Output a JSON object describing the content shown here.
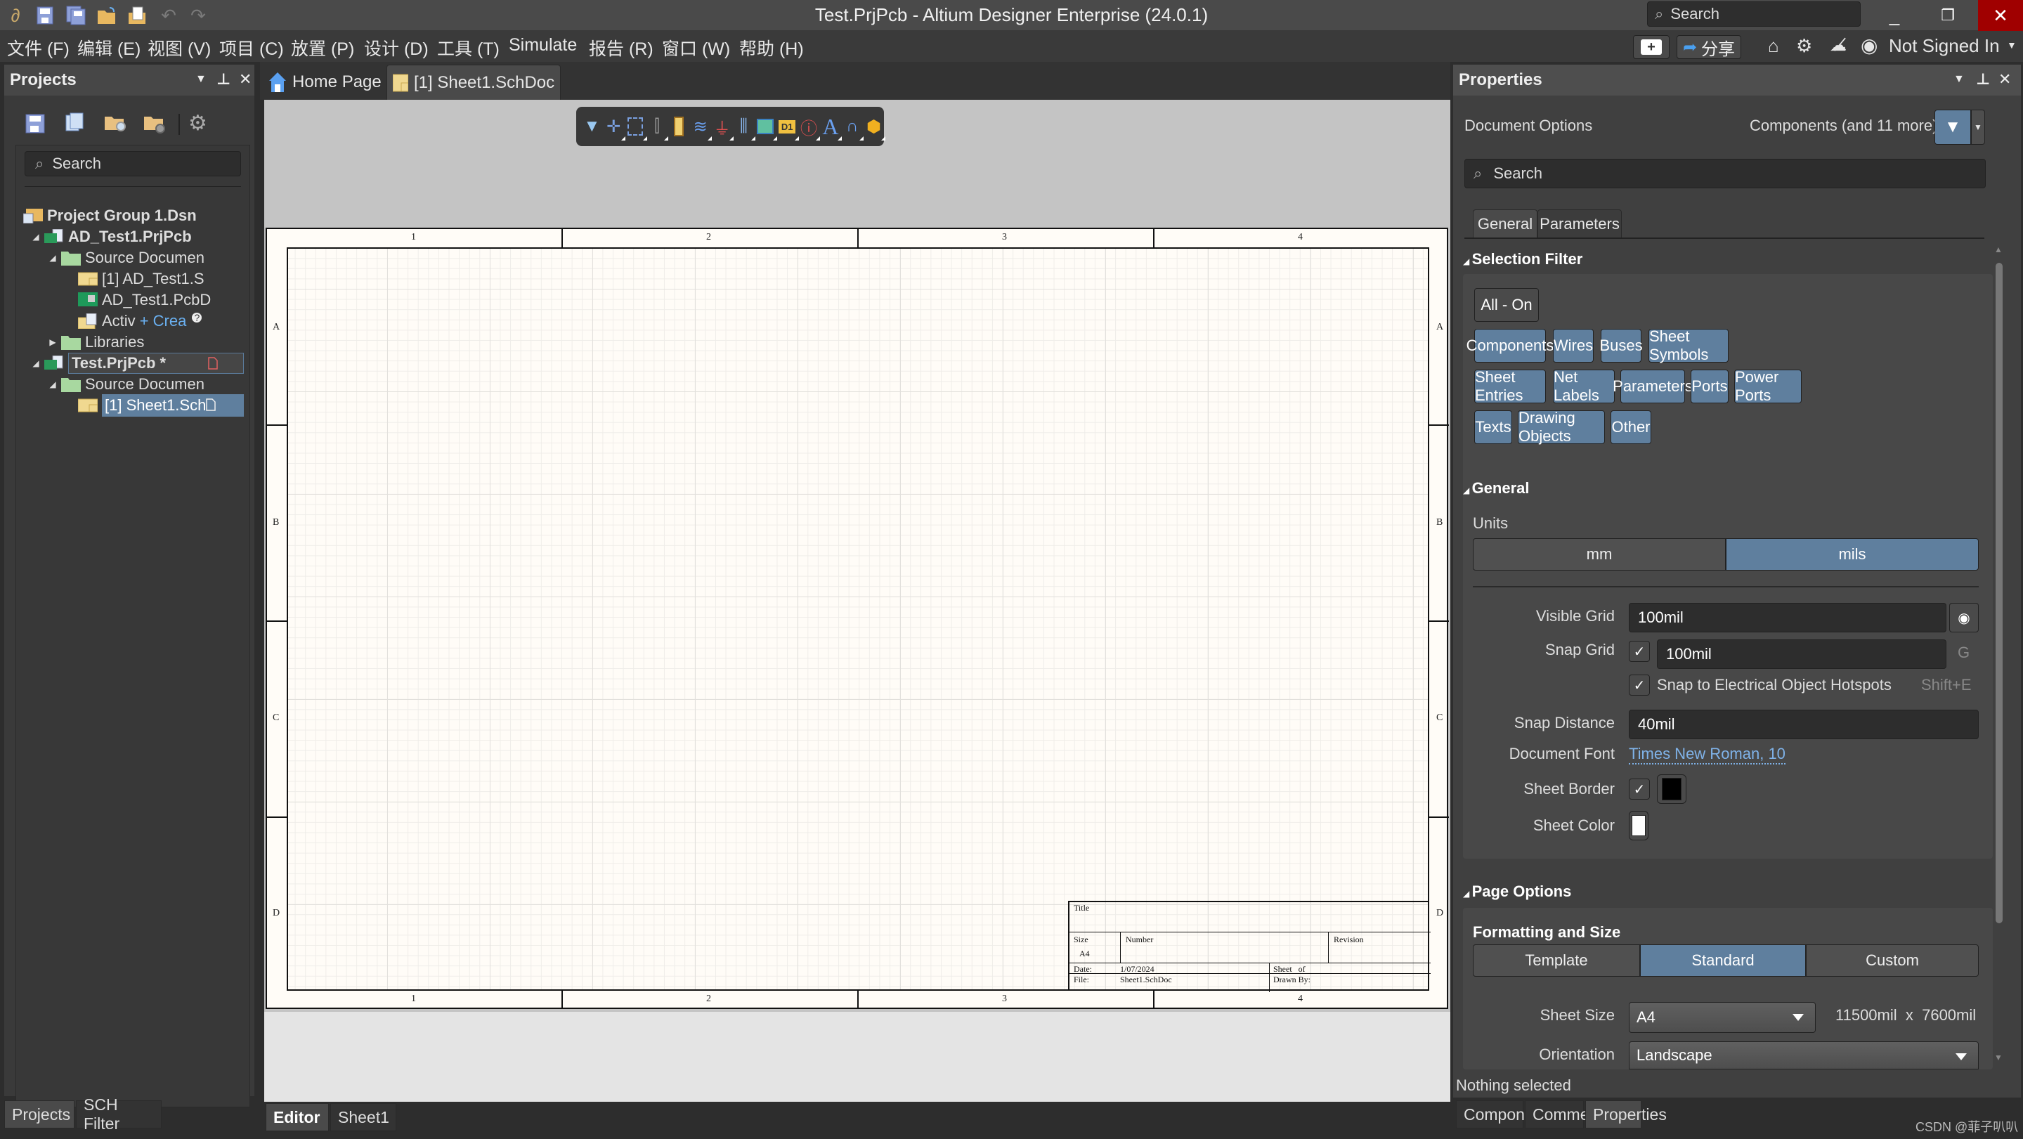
{
  "titlebar": {
    "title": "Test.PrjPcb - Altium Designer Enterprise (24.0.1)",
    "search_placeholder": "Search",
    "quick_access": [
      "altium-logo",
      "save",
      "save-all",
      "open",
      "open-project",
      "undo",
      "redo"
    ]
  },
  "menubar": {
    "items": [
      "文件 (F)",
      "编辑 (E)",
      "视图 (V)",
      "项目 (C)",
      "放置 (P)",
      "设计 (D)",
      "工具 (T)",
      "Simulate",
      "报告 (R)",
      "窗口 (W)",
      "帮助 (H)"
    ],
    "share_label": "分享",
    "account_label": "Not Signed In"
  },
  "projects_panel": {
    "title": "Projects",
    "search_placeholder": "Search",
    "tree": [
      {
        "label": "Project Group 1.Dsn",
        "level": 0,
        "bold": true,
        "icon": "project-group"
      },
      {
        "label": "AD_Test1.PrjPcb",
        "level": 1,
        "bold": true,
        "icon": "pcb-project",
        "expanded": true
      },
      {
        "label": "Source Documen",
        "level": 2,
        "icon": "folder",
        "expanded": true
      },
      {
        "label": "[1] AD_Test1.S",
        "level": 3,
        "icon": "schdoc"
      },
      {
        "label": "AD_Test1.PcbD",
        "level": 3,
        "icon": "pcbdoc"
      },
      {
        "label": "Activ",
        "level": 3,
        "icon": "activebom",
        "link": "+ Crea"
      },
      {
        "label": "Libraries",
        "level": 2,
        "icon": "folder",
        "expanded": false
      },
      {
        "label": "Test.PrjPcb *",
        "level": 1,
        "bold": true,
        "icon": "pcb-project",
        "expanded": true,
        "focused": true
      },
      {
        "label": "Source Documen",
        "level": 2,
        "icon": "folder",
        "expanded": true
      },
      {
        "label": "[1] Sheet1.Sch",
        "level": 3,
        "icon": "schdoc",
        "selected": true
      }
    ],
    "bottom_tabs": [
      "Projects",
      "SCH Filter"
    ]
  },
  "document_tabs": [
    {
      "label": "Home Page",
      "icon": "home"
    },
    {
      "label": "[1] Sheet1.SchDoc",
      "icon": "schdoc",
      "active": true
    }
  ],
  "sheet": {
    "col_labels": [
      "1",
      "2",
      "3",
      "4"
    ],
    "row_labels": [
      "A",
      "B",
      "C",
      "D"
    ],
    "title_block": {
      "title_label": "Title",
      "size_label": "Size",
      "size_value": "A4",
      "number_label": "Number",
      "revision_label": "Revision",
      "date_label": "Date:",
      "date_value": "1/07/2024",
      "file_label": "File:",
      "file_value": "Sheet1.SchDoc",
      "sheet_label": "Sheet   of",
      "drawn_by_label": "Drawn By:"
    }
  },
  "editor_bottom_tabs": [
    "Editor",
    "Sheet1"
  ],
  "properties": {
    "title": "Properties",
    "doc_options_label": "Document Options",
    "filter_summary": "Components (and 11 more)",
    "search_placeholder": "Search",
    "tabs": [
      "General",
      "Parameters"
    ],
    "selection_filter": {
      "title": "Selection Filter",
      "all_on_label": "All - On",
      "buttons": [
        "Components",
        "Wires",
        "Buses",
        "Sheet Symbols",
        "Sheet Entries",
        "Net Labels",
        "Parameters",
        "Ports",
        "Power Ports",
        "Texts",
        "Drawing Objects",
        "Other"
      ]
    },
    "general": {
      "title": "General",
      "units_label": "Units",
      "units_options": [
        "mm",
        "mils"
      ],
      "units_selected": "mils",
      "visible_grid_label": "Visible Grid",
      "visible_grid_value": "100mil",
      "snap_grid_label": "Snap Grid",
      "snap_grid_value": "100mil",
      "snap_grid_checked": true,
      "snap_grid_shortcut": "G",
      "snap_hotspots_label": "Snap to Electrical Object Hotspots",
      "snap_hotspots_checked": true,
      "snap_hotspots_shortcut": "Shift+E",
      "snap_distance_label": "Snap Distance",
      "snap_distance_value": "40mil",
      "document_font_label": "Document Font",
      "document_font_value": "Times New Roman, 10",
      "sheet_border_label": "Sheet Border",
      "sheet_border_checked": true,
      "sheet_border_color": "#000000",
      "sheet_color_label": "Sheet Color",
      "sheet_color": "#FFFFFF"
    },
    "page_options": {
      "title": "Page Options",
      "formatting_label": "Formatting and Size",
      "mode_options": [
        "Template",
        "Standard",
        "Custom"
      ],
      "mode_selected": "Standard",
      "sheet_size_label": "Sheet Size",
      "sheet_size_value": "A4",
      "sheet_dimensions": "11500mil  x  7600mil",
      "orientation_label": "Orientation",
      "orientation_value": "Landscape"
    },
    "status": "Nothing selected",
    "bottom_tabs": [
      "Components",
      "Comments",
      "Properties"
    ]
  },
  "watermark": "CSDN @菲子叭叭",
  "colors": {
    "accent": "#5F7F9E",
    "close_red": "#A00000",
    "link": "#7FB2E8"
  }
}
